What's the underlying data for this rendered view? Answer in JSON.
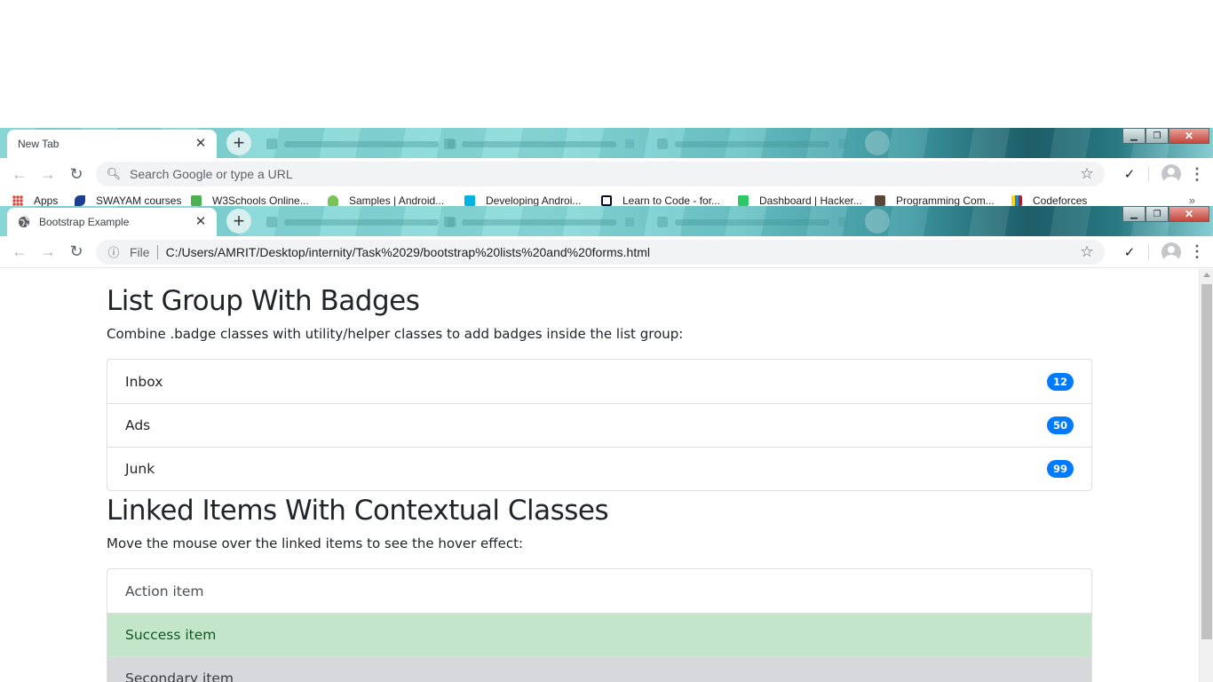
{
  "browser1": {
    "tab_title": "New Tab",
    "omnibox_placeholder": "Search Google or type a URL",
    "bookmarks": [
      {
        "label": "Apps",
        "icon": "apps-grid-icon",
        "color": "#ea4335"
      },
      {
        "label": "SWAYAM courses",
        "icon": "swayam-icon",
        "color": "#1a3f8f"
      },
      {
        "label": "W3Schools Online...",
        "icon": "w3schools-icon",
        "color": "#4caf50"
      },
      {
        "label": "Samples | Android...",
        "icon": "android-icon",
        "color": "#78c257"
      },
      {
        "label": "Developing Androi...",
        "icon": "udacity-icon",
        "color": "#02b3e4"
      },
      {
        "label": "Learn to Code - for...",
        "icon": "freecodecamp-icon",
        "color": "#0a0a23"
      },
      {
        "label": "Dashboard | Hacker...",
        "icon": "hackerrank-icon",
        "color": "#2ec866"
      },
      {
        "label": "Programming Com...",
        "icon": "codechef-icon",
        "color": "#5b4638"
      },
      {
        "label": "Codeforces",
        "icon": "codeforces-icon",
        "color": "#1f8acb"
      }
    ],
    "bookmarks_more": "»"
  },
  "browser2": {
    "tab_title": "Bootstrap Example",
    "omnibox_scheme": "File",
    "omnibox_url": "C:/Users/AMRIT/Desktop/internity/Task%2029/bootstrap%20lists%20and%20forms.html"
  },
  "page": {
    "section1": {
      "heading": "List Group With Badges",
      "description": "Combine .badge classes with utility/helper classes to add badges inside the list group:",
      "items": [
        {
          "label": "Inbox",
          "badge": "12"
        },
        {
          "label": "Ads",
          "badge": "50"
        },
        {
          "label": "Junk",
          "badge": "99"
        }
      ]
    },
    "section2": {
      "heading": "Linked Items With Contextual Classes",
      "description": "Move the mouse over the linked items to see the hover effect:",
      "items": [
        {
          "label": "Action item",
          "variant": "action"
        },
        {
          "label": "Success item",
          "variant": "success"
        },
        {
          "label": "Secondary item",
          "variant": "secondary"
        }
      ]
    }
  },
  "colors": {
    "badge_primary": "#007bff",
    "success_bg": "#c3e6cb",
    "secondary_bg": "#d6d8db"
  }
}
